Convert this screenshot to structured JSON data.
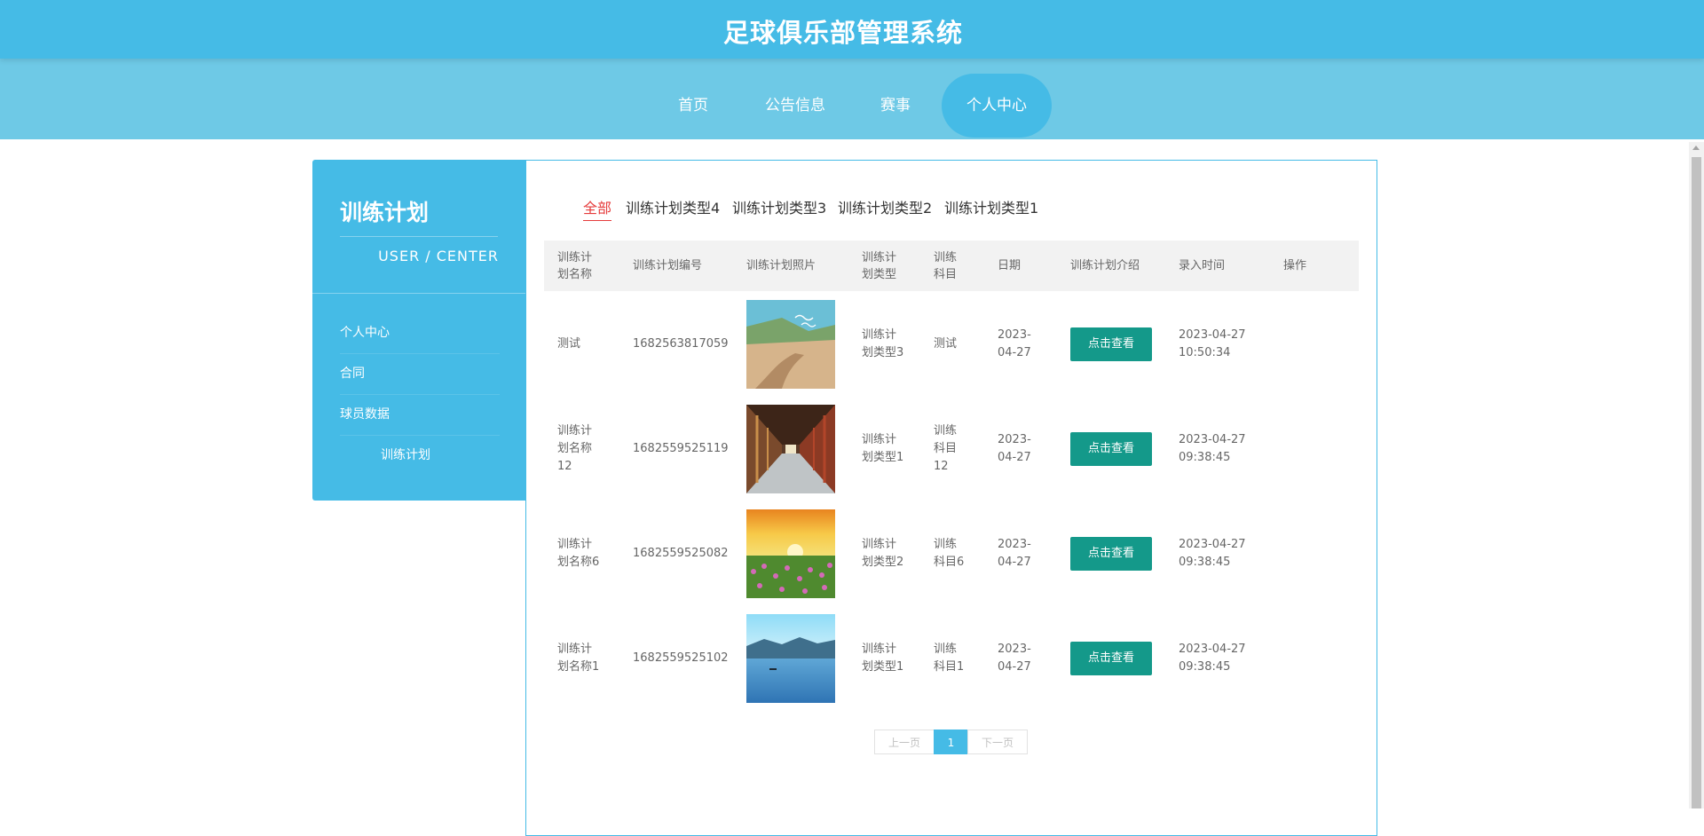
{
  "app": {
    "title": "足球俱乐部管理系统"
  },
  "nav": [
    {
      "label": "首页"
    },
    {
      "label": "公告信息"
    },
    {
      "label": "赛事"
    },
    {
      "label": "个人中心",
      "active": true
    }
  ],
  "sidebar": {
    "title": "训练计划",
    "subtitle": "USER / CENTER",
    "items": [
      {
        "label": "个人中心"
      },
      {
        "label": "合同"
      },
      {
        "label": "球员数据"
      },
      {
        "label": "训练计划"
      }
    ]
  },
  "categories": [
    {
      "label": "全部",
      "active": true
    },
    {
      "label": "训练计划类型4"
    },
    {
      "label": "训练计划类型3"
    },
    {
      "label": "训练计划类型2"
    },
    {
      "label": "训练计划类型1"
    }
  ],
  "table": {
    "columns": [
      {
        "line1": "训练计",
        "line2": "划名称"
      },
      {
        "line1": "训练计划编号",
        "line2": ""
      },
      {
        "line1": "训练计划照片",
        "line2": ""
      },
      {
        "line1": "训练计",
        "line2": "划类型"
      },
      {
        "line1": "训练",
        "line2": "科目"
      },
      {
        "line1": "日期",
        "line2": ""
      },
      {
        "line1": "训练计划介绍",
        "line2": ""
      },
      {
        "line1": "录入时间",
        "line2": ""
      },
      {
        "line1": "操作",
        "line2": ""
      }
    ],
    "rows": [
      {
        "name": [
          "测试"
        ],
        "code": "1682563817059",
        "photo": "canyon-river",
        "type": [
          "训练计",
          "划类型3"
        ],
        "subject": [
          "测试"
        ],
        "date": [
          "2023-",
          "04-27"
        ],
        "intro_button": "点击查看",
        "created": [
          "2023-04-27",
          "10:50:34"
        ]
      },
      {
        "name": [
          "训练计",
          "划名称",
          "12"
        ],
        "code": "1682559525119",
        "photo": "temple-corridor",
        "type": [
          "训练计",
          "划类型1"
        ],
        "subject": [
          "训练",
          "科目",
          "12"
        ],
        "date": [
          "2023-",
          "04-27"
        ],
        "intro_button": "点击查看",
        "created": [
          "2023-04-27",
          "09:38:45"
        ]
      },
      {
        "name": [
          "训练计",
          "划名称6"
        ],
        "code": "1682559525082",
        "photo": "sunset-flowers",
        "type": [
          "训练计",
          "划类型2"
        ],
        "subject": [
          "训练",
          "科目6"
        ],
        "date": [
          "2023-",
          "04-27"
        ],
        "intro_button": "点击查看",
        "created": [
          "2023-04-27",
          "09:38:45"
        ]
      },
      {
        "name": [
          "训练计",
          "划名称1"
        ],
        "code": "1682559525102",
        "photo": "blue-lake",
        "type": [
          "训练计",
          "划类型1"
        ],
        "subject": [
          "训练",
          "科目1"
        ],
        "date": [
          "2023-",
          "04-27"
        ],
        "intro_button": "点击查看",
        "created": [
          "2023-04-27",
          "09:38:45"
        ]
      }
    ]
  },
  "pagination": {
    "prev": "上一页",
    "current": "1",
    "next": "下一页"
  },
  "colors": {
    "header": "#45bbe6",
    "nav": "#6ec9e6",
    "button": "#14998a",
    "active_category": "#e53b3b"
  }
}
